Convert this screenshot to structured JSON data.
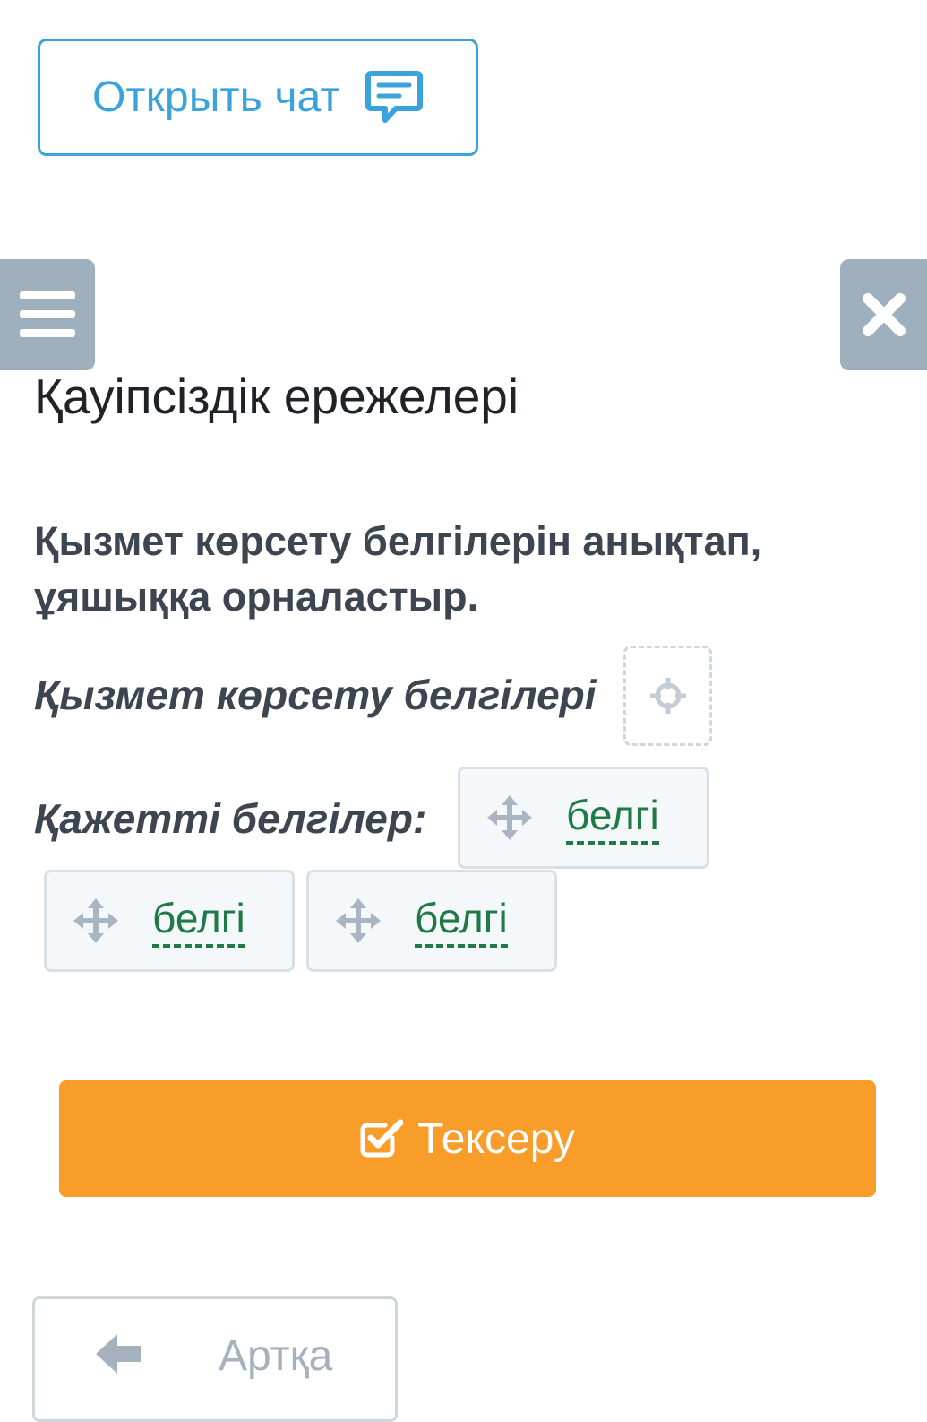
{
  "chat_button": {
    "label": "Открыть чат",
    "icon": "chat-icon"
  },
  "menu_button": {
    "icon": "hamburger-menu-icon"
  },
  "close_button": {
    "icon": "close-icon"
  },
  "page_title": "Қауіпсіздік ережелері",
  "instruction": "Қызмет көрсету белгілерін анықтап, ұяшыққа орналастыр.",
  "task": {
    "target_label": "Қызмет көрсету белгілері",
    "target_icon": "crosshair-icon",
    "options_label": "Қажетті белгілер:",
    "options": [
      {
        "label": "белгі",
        "icon": "move-icon"
      },
      {
        "label": "белгі",
        "icon": "move-icon"
      },
      {
        "label": "белгі",
        "icon": "move-icon"
      }
    ]
  },
  "check_button": {
    "label": "Тексеру",
    "icon": "check-square-icon"
  },
  "back_button": {
    "label": "Артқа",
    "icon": "arrow-left-icon"
  },
  "colors": {
    "chat_accent": "#3aa3dc",
    "side_button": "#9eafbd",
    "check_button": "#f99d2a",
    "option_text": "#1f7a45"
  }
}
